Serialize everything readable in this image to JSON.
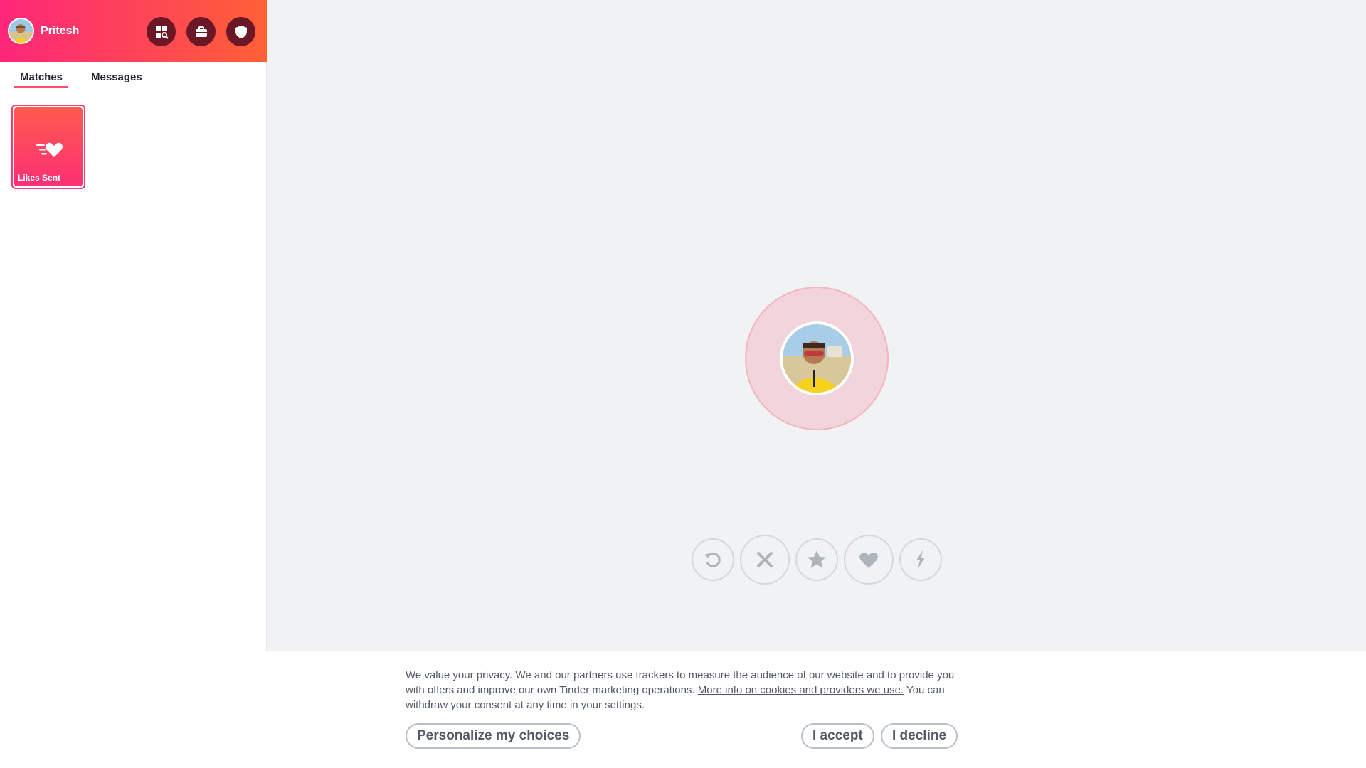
{
  "header": {
    "user_name": "Pritesh",
    "buttons": [
      "explore-icon",
      "briefcase-icon",
      "shield-icon"
    ]
  },
  "tabs": [
    {
      "label": "Matches",
      "active": true
    },
    {
      "label": "Messages",
      "active": false
    }
  ],
  "likes_card": {
    "label": "Likes Sent"
  },
  "actions": [
    "rewind-icon",
    "nope-icon",
    "super-like-icon",
    "like-icon",
    "boost-icon"
  ],
  "cookie": {
    "text_1": "We value your privacy. We and our partners use trackers to measure the audience of our website and to provide you with offers and improve our own Tinder marketing operations. ",
    "link": "More info on cookies and providers we use.",
    "text_2": " You can withdraw your consent at any time in your settings.",
    "personalize_label": "Personalize my choices",
    "accept_label": "I accept",
    "decline_label": "I decline"
  },
  "colors": {
    "brand_gradient_start": "#fd267a",
    "brand_gradient_end": "#ff6036",
    "top_button_bg": "#6b1725",
    "tab_underline": "#fd5068"
  }
}
